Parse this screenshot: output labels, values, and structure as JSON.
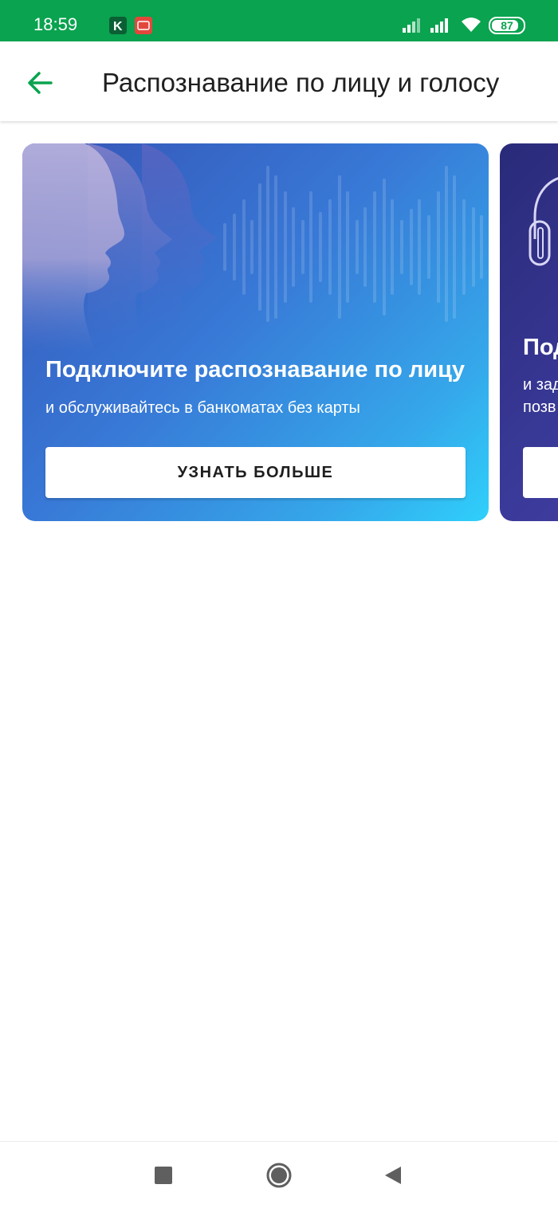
{
  "status_bar": {
    "time": "18:59",
    "battery_level": "87",
    "battery_fraction": 0.87,
    "notification_icons": [
      "kaspersky-icon",
      "app-notification-icon"
    ],
    "system_icons": [
      "signal-icon",
      "signal-icon",
      "wifi-icon",
      "battery-icon"
    ],
    "background_color": "#0aa34f"
  },
  "app_bar": {
    "back_icon": "arrow-left-icon",
    "title": "Распознавание по лицу и голосу",
    "accent_color": "#0aa34f"
  },
  "cards": [
    {
      "title": "Подключите распознавание по лицу",
      "subtitle": "и обслуживайтесь в банкоматах без карты",
      "button_label": "УЗНАТЬ БОЛЬШЕ",
      "illustration": "face-profiles-illustration"
    },
    {
      "title": "Под",
      "subtitle_line1": "и зад",
      "subtitle_line2": "позв",
      "illustration": "headphones-icon"
    }
  ],
  "nav_bar": {
    "recents_icon": "square-icon",
    "home_icon": "circle-icon",
    "back_icon": "triangle-back-icon"
  }
}
